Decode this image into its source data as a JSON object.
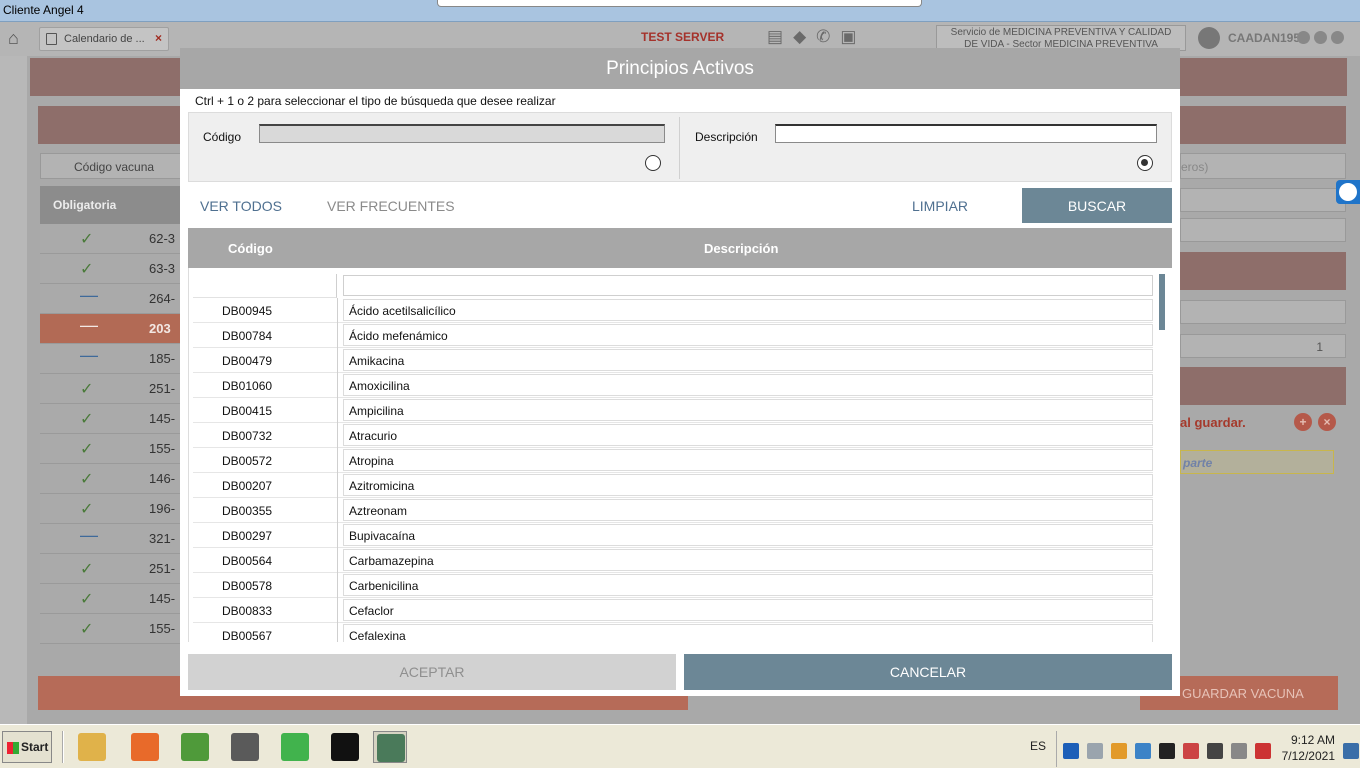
{
  "window": {
    "title": "Cliente Angel 4"
  },
  "app": {
    "tab_label": "Calendario de ...",
    "tab_close": "×",
    "server_label": "TEST SERVER",
    "service_line1": "Servicio de MEDICINA PREVENTIVA Y CALIDAD",
    "service_line2": "DE VIDA - Sector MEDICINA PREVENTIVA",
    "user": "CAADAN195",
    "bg_field_label": "Código vacuna",
    "bg_header": "Obligatoria",
    "bg_rows": [
      {
        "mark": "check",
        "code": "62-3"
      },
      {
        "mark": "check",
        "code": "63-3"
      },
      {
        "mark": "dash",
        "code": "264-"
      },
      {
        "mark": "dash",
        "code": "203",
        "selected": true
      },
      {
        "mark": "dash",
        "code": "185-"
      },
      {
        "mark": "check",
        "code": "251-"
      },
      {
        "mark": "check",
        "code": "145-"
      },
      {
        "mark": "check",
        "code": "155-"
      },
      {
        "mark": "check",
        "code": "146-"
      },
      {
        "mark": "check",
        "code": "196-"
      },
      {
        "mark": "dash",
        "code": "321-"
      },
      {
        "mark": "check",
        "code": "251-"
      },
      {
        "mark": "check",
        "code": "145-"
      },
      {
        "mark": "check",
        "code": "155-"
      }
    ],
    "bg_right_placeholder": "eros)",
    "bg_right_stepper": "1",
    "bg_right_warning": "al guardar.",
    "bg_right_yellow": "parte",
    "bg_save_button": "GUARDAR VACUNA"
  },
  "modal": {
    "title": "Principios Activos",
    "hint": "Ctrl + 1 o 2 para seleccionar el tipo de búsqueda que desee realizar",
    "codigo_label": "Código",
    "codigo_value": "",
    "descripcion_label": "Descripción",
    "descripcion_value": "",
    "ver_todos": "VER TODOS",
    "ver_frecuentes": "VER FRECUENTES",
    "limpiar": "LIMPIAR",
    "buscar": "BUSCAR",
    "col_codigo": "Código",
    "col_descripcion": "Descripción",
    "rows": [
      {
        "code": "DB00945",
        "desc": "Ácido acetilsalicílico"
      },
      {
        "code": "DB00784",
        "desc": "Ácido mefenámico"
      },
      {
        "code": "DB00479",
        "desc": "Amikacina"
      },
      {
        "code": "DB01060",
        "desc": "Amoxicilina"
      },
      {
        "code": "DB00415",
        "desc": "Ampicilina"
      },
      {
        "code": "DB00732",
        "desc": "Atracurio"
      },
      {
        "code": "DB00572",
        "desc": "Atropina"
      },
      {
        "code": "DB00207",
        "desc": "Azitromicina"
      },
      {
        "code": "DB00355",
        "desc": "Aztreonam"
      },
      {
        "code": "DB00297",
        "desc": "Bupivacaína"
      },
      {
        "code": "DB00564",
        "desc": "Carbamazepina"
      },
      {
        "code": "DB00578",
        "desc": "Carbenicilina"
      },
      {
        "code": "DB00833",
        "desc": "Cefaclor"
      },
      {
        "code": "DB00567",
        "desc": "Cefalexina"
      }
    ],
    "aceptar": "ACEPTAR",
    "cancelar": "CANCELAR"
  },
  "taskbar": {
    "start": "Start",
    "apps": [
      "file-explorer-icon",
      "firefox-icon",
      "notepad-icon",
      "sublime-text-icon",
      "qt-creator-icon",
      "terminal-icon",
      "angel-client-icon"
    ],
    "lang": "ES",
    "time": "9:12 AM",
    "date": "7/12/2021"
  },
  "colors": {
    "accent": "#6c8796",
    "header_gray": "#a7a7a7",
    "test_server": "#a5322b",
    "selected_row": "#b26a55"
  }
}
